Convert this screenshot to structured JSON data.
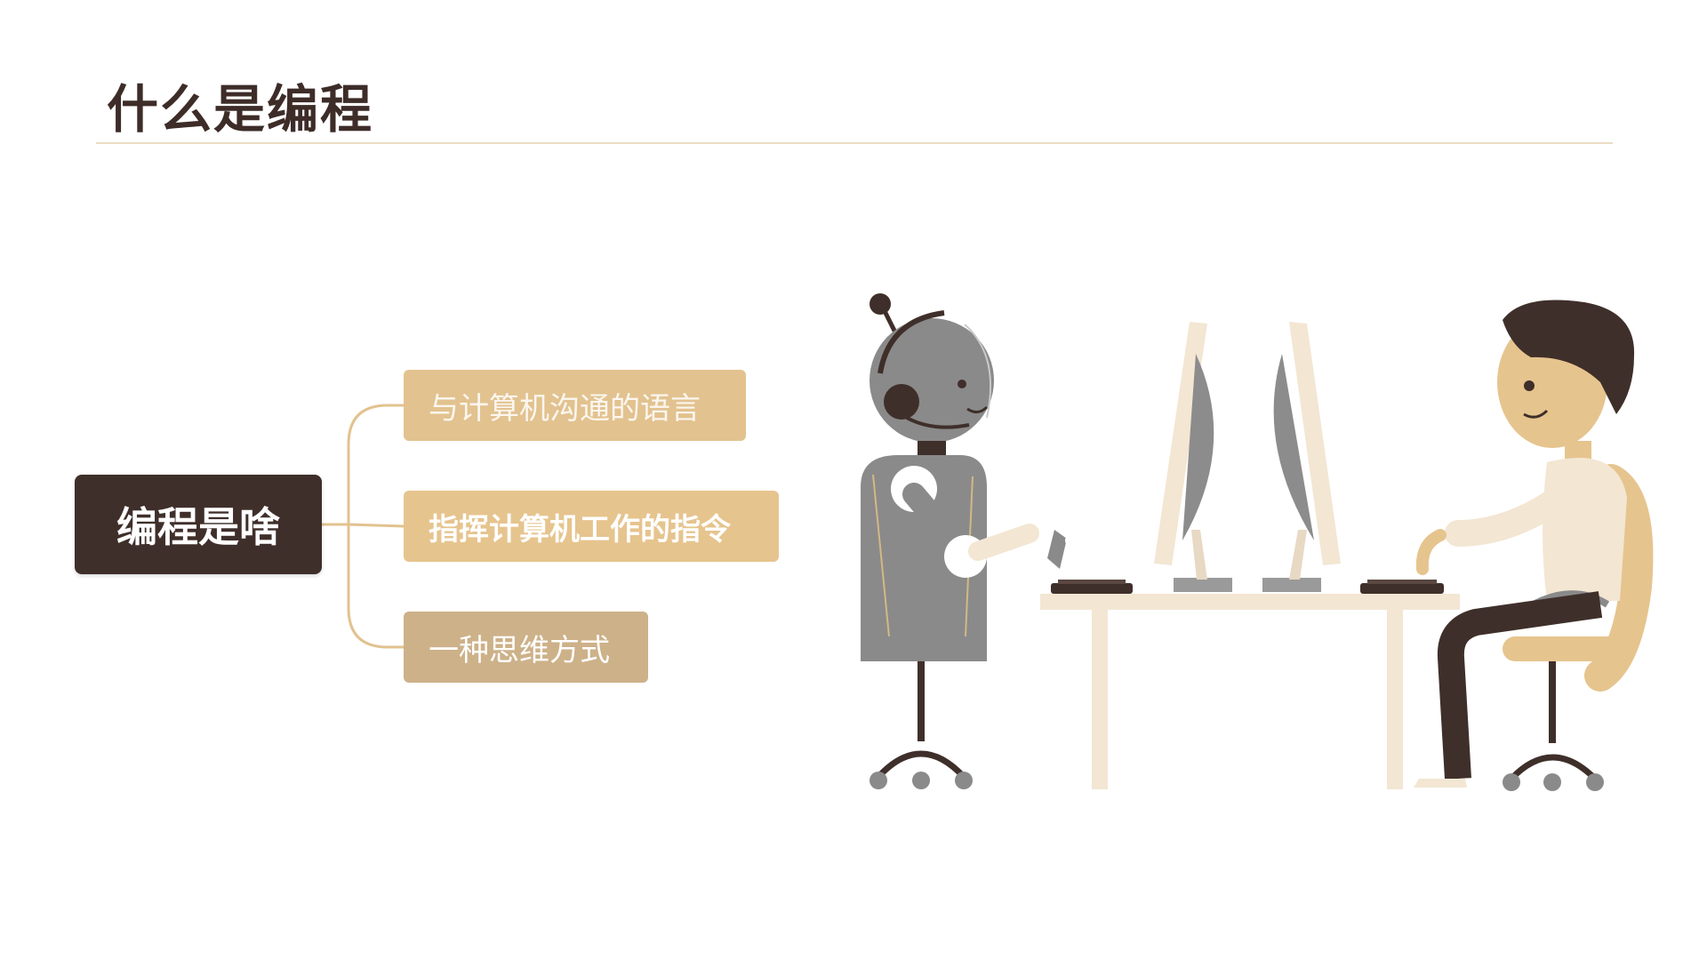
{
  "slide": {
    "title": "什么是编程"
  },
  "mindmap": {
    "root": "编程是啥",
    "branches": [
      {
        "label": "与计算机沟通的语言"
      },
      {
        "label": "指挥计算机工作的指令"
      },
      {
        "label": "一种思维方式"
      }
    ]
  },
  "colors": {
    "dark_brown": "#3f2f2a",
    "tan": "#e2c28f",
    "muted_tan": "#cdb189",
    "rule": "#ecdcc4",
    "robot_gray": "#8a8a8a",
    "desk_cream": "#f3e6d3"
  },
  "illustration": {
    "scene": "robot-and-person-at-computers"
  }
}
